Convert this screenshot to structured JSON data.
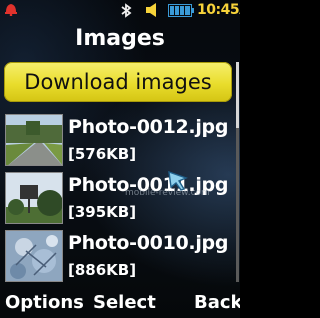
{
  "status": {
    "time": "10:45AM",
    "icons": [
      "alarm-icon",
      "bluetooth-icon",
      "volume-icon",
      "battery-icon"
    ],
    "accent_color": "#f7d33a"
  },
  "header": {
    "title": "Images"
  },
  "download": {
    "label": "Download images",
    "color": "#e9dd2c"
  },
  "list": [
    {
      "name": "Photo-0012.jpg",
      "size": "[576KB]"
    },
    {
      "name": "Photo-0011.jpg",
      "size": "[395KB]"
    },
    {
      "name": "Photo-0010.jpg",
      "size": "[886KB]"
    }
  ],
  "softkeys": {
    "left": "Options",
    "center": "Select",
    "right": "Back"
  },
  "watermark": "mobile-review.com"
}
